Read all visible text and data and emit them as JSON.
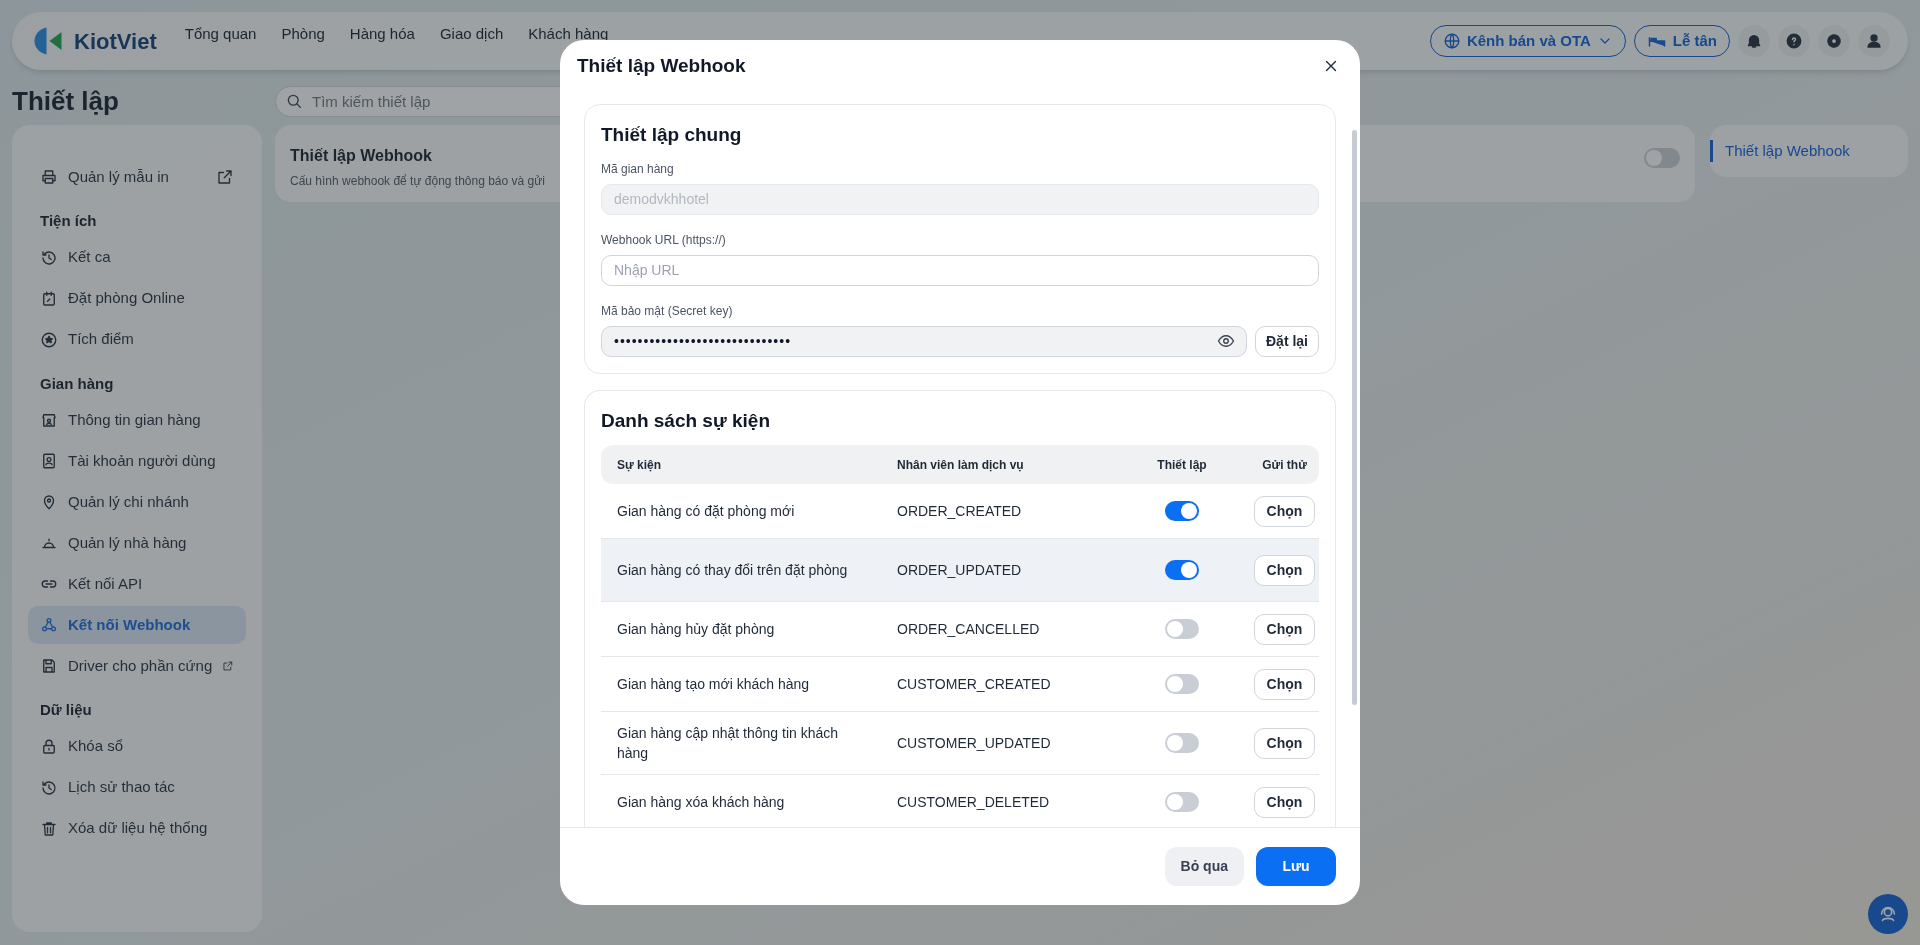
{
  "nav": {
    "logo": "KiotViet",
    "items": [
      "Tổng quan",
      "Phòng",
      "Hàng hóa",
      "Giao dịch",
      "Khách hàng"
    ],
    "channel_button": "Kênh bán và OTA",
    "reception_button": "Lễ tân"
  },
  "page": {
    "title": "Thiết lập",
    "search_placeholder": "Tìm kiếm thiết lập"
  },
  "sidebar": {
    "groups": [
      {
        "items": [
          {
            "label": "Quản lý mẫu in",
            "external": true,
            "selected": false
          }
        ]
      },
      {
        "heading": "Tiện ích",
        "items": [
          {
            "label": "Kết ca",
            "external": false,
            "selected": false
          },
          {
            "label": "Đặt phòng Online",
            "external": false,
            "selected": false
          },
          {
            "label": "Tích điểm",
            "external": false,
            "selected": false
          }
        ]
      },
      {
        "heading": "Gian hàng",
        "items": [
          {
            "label": "Thông tin gian hàng",
            "external": false,
            "selected": false
          },
          {
            "label": "Tài khoản người dùng",
            "external": false,
            "selected": false
          },
          {
            "label": "Quản lý chi nhánh",
            "external": false,
            "selected": false
          },
          {
            "label": "Quản lý nhà hàng",
            "external": false,
            "selected": false
          },
          {
            "label": "Kết nối API",
            "external": false,
            "selected": false
          },
          {
            "label": "Kết nối Webhook",
            "external": false,
            "selected": true
          },
          {
            "label": "Driver cho phần cứng",
            "external": true,
            "selected": false
          }
        ]
      },
      {
        "heading": "Dữ liệu",
        "items": [
          {
            "label": "Khóa sổ",
            "external": false,
            "selected": false
          },
          {
            "label": "Lịch sử thao tác",
            "external": false,
            "selected": false
          },
          {
            "label": "Xóa dữ liệu hệ thống",
            "external": false,
            "selected": false
          }
        ]
      }
    ]
  },
  "card": {
    "title": "Thiết lập Webhook",
    "description": "Cấu hình webhook để tự động thông báo và gửi",
    "on": false
  },
  "toc": {
    "items": [
      {
        "label": "Thiết lập Webhook",
        "selected": true
      }
    ]
  },
  "modal": {
    "title": "Thiết lập Webhook",
    "general": {
      "heading": "Thiết lập chung",
      "fields": [
        {
          "kind": "readonly",
          "label": "Mã gian hàng",
          "value": "demodvkhhotel"
        },
        {
          "kind": "input",
          "label": "Webhook URL (https://)",
          "placeholder": "Nhập URL"
        },
        {
          "kind": "secret",
          "label": "Mã bảo mật (Secret key)",
          "value": "••••••••••••••••••••••••••••••",
          "button": "Đặt lại"
        }
      ]
    },
    "events": {
      "heading": "Danh sách sự kiện",
      "columns": [
        "Sự kiện",
        "Nhân viên làm dịch vụ",
        "Thiết lập",
        "Gửi thử"
      ],
      "rows": [
        {
          "event": "Gian hàng có đặt phòng mới",
          "service": "ORDER_CREATED",
          "on": true,
          "highlighted": false,
          "action": "Chọn"
        },
        {
          "event": "Gian hàng có thay đổi trên đặt phòng",
          "service": "ORDER_UPDATED",
          "on": true,
          "highlighted": true,
          "action": "Chọn"
        },
        {
          "event": "Gian hàng hủy đặt phòng",
          "service": "ORDER_CANCELLED",
          "on": false,
          "highlighted": false,
          "action": "Chọn"
        },
        {
          "event": "Gian hàng tạo mới khách hàng",
          "service": "CUSTOMER_CREATED",
          "on": false,
          "highlighted": false,
          "action": "Chọn"
        },
        {
          "event": "Gian hàng cập nhật thông tin khách hàng",
          "service": "CUSTOMER_UPDATED",
          "on": false,
          "highlighted": false,
          "action": "Chọn"
        },
        {
          "event": "Gian hàng xóa khách hàng",
          "service": "CUSTOMER_DELETED",
          "on": false,
          "highlighted": false,
          "action": "Chọn"
        }
      ]
    },
    "cancel_button": "Bỏ qua",
    "save_button": "Lưu"
  }
}
